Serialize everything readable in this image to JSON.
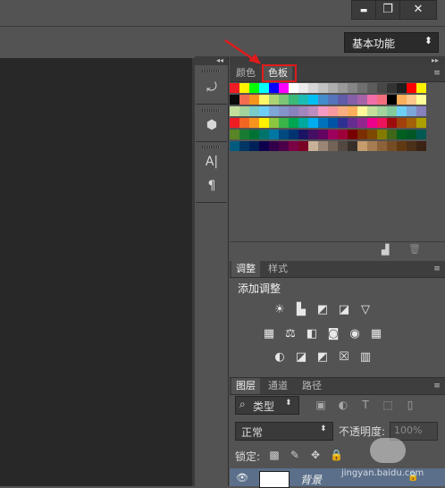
{
  "window": {
    "minimize_icon": "minimize-icon",
    "restore_icon": "restore-icon",
    "close_icon": "close-icon",
    "minimize_glyph": "▬",
    "restore_glyph": "❐",
    "close_glyph": "✕"
  },
  "options_bar": {
    "workspace_label": "基本功能",
    "workspace_arrow": "⬍"
  },
  "tool_dock": {
    "collapse": "◂◂",
    "buttons": [
      {
        "icon": "history-icon",
        "glyph": "⤾"
      },
      {
        "icon": "cube-icon",
        "glyph": "⬢"
      },
      {
        "icon": "character-icon",
        "glyph": "A|"
      },
      {
        "icon": "paragraph-icon",
        "glyph": "¶"
      }
    ]
  },
  "color_panel": {
    "tabs": [
      "颜色",
      "色板"
    ],
    "active_tab": "色板",
    "expand": "▸▸",
    "menu": "≡",
    "swatch_rows": [
      [
        "#ed1c24",
        "#fff200",
        "#00ff00",
        "#00ffff",
        "#0000ff",
        "#ff00ff",
        "#ffffff",
        "#ebebeb",
        "#d6d6d6",
        "#c2c2c2",
        "#adadad",
        "#999999",
        "#858585",
        "#707070",
        "#5c5c5c",
        "#474747",
        "#333333",
        "#1f1f1f",
        "#ff0000",
        "#fff200"
      ],
      [
        "#0a0a0a",
        "#f26c4f",
        "#f7941d",
        "#fff568",
        "#acd373",
        "#7cc576",
        "#3cb878",
        "#1cbbb4",
        "#00bff3",
        "#448ccb",
        "#5574b9",
        "#605ca8",
        "#8560a8",
        "#a763a8",
        "#f06ea9",
        "#f26d7d",
        "#000000",
        "#fbaf5d",
        "#fdc68a",
        "#ffff99"
      ],
      [
        "#c4df9b",
        "#a3d39c",
        "#7accc8",
        "#6dcff6",
        "#7ea7d8",
        "#8493ca",
        "#8882be",
        "#a187be",
        "#bc8dbf",
        "#f49ac2",
        "#f6989d",
        "#f9ad81",
        "#fbaf5d",
        "#fff79a",
        "#c4df9b",
        "#a3d39c",
        "#82ca9c",
        "#6ecff6",
        "#7da7d9",
        "#8781bd"
      ],
      [
        "#ee1d24",
        "#f26522",
        "#f7941d",
        "#fff200",
        "#8dc63f",
        "#39b54a",
        "#00a651",
        "#00a99d",
        "#00aeef",
        "#0072bc",
        "#0054a6",
        "#2e3192",
        "#662d91",
        "#92278f",
        "#ec008c",
        "#ed145b",
        "#9e0b0f",
        "#a0410d",
        "#a36209",
        "#aba000"
      ],
      [
        "#598527",
        "#197b30",
        "#007236",
        "#00746b",
        "#0076a3",
        "#004a80",
        "#003471",
        "#1b1464",
        "#440e62",
        "#630460",
        "#9e005d",
        "#9e0039",
        "#790000",
        "#7b2e00",
        "#7d4900",
        "#827b00",
        "#406618",
        "#005e20",
        "#005826",
        "#005952"
      ],
      [
        "#005b7f",
        "#003663",
        "#002157",
        "#0d004c",
        "#32004b",
        "#4b0049",
        "#7b0046",
        "#7a0026",
        "#c7b299",
        "#998675",
        "#736357",
        "#534741",
        "#37302a",
        "#c69c6d",
        "#a67c52",
        "#8c6239",
        "#754c24",
        "#603913",
        "#4a3018",
        "#3b2314"
      ]
    ],
    "footer_icons": [
      "new-swatch-icon",
      "trash-icon"
    ],
    "footer_glyphs": [
      "▟",
      "🗑"
    ]
  },
  "adjustments_panel": {
    "tabs": [
      "调整",
      "样式"
    ],
    "active_tab": "调整",
    "heading": "添加调整",
    "menu": "≡",
    "icon_rows": [
      [
        {
          "name": "brightness-icon",
          "glyph": "☀"
        },
        {
          "name": "levels-icon",
          "glyph": "▙"
        },
        {
          "name": "curves-icon",
          "glyph": "◩"
        },
        {
          "name": "exposure-icon",
          "glyph": "◪"
        },
        {
          "name": "vibrance-icon",
          "glyph": "▽"
        }
      ],
      [
        {
          "name": "hue-saturation-icon",
          "glyph": "▦"
        },
        {
          "name": "color-balance-icon",
          "glyph": "⚖"
        },
        {
          "name": "black-white-icon",
          "glyph": "◧"
        },
        {
          "name": "photo-filter-icon",
          "glyph": "◙"
        },
        {
          "name": "channel-mixer-icon",
          "glyph": "◉"
        },
        {
          "name": "color-lookup-icon",
          "glyph": "▦"
        }
      ],
      [
        {
          "name": "invert-icon",
          "glyph": "◐"
        },
        {
          "name": "posterize-icon",
          "glyph": "◪"
        },
        {
          "name": "threshold-icon",
          "glyph": "◩"
        },
        {
          "name": "selective-color-icon",
          "glyph": "☒"
        },
        {
          "name": "gradient-map-icon",
          "glyph": "▥"
        }
      ]
    ]
  },
  "layers_panel": {
    "tabs": [
      "图层",
      "通道",
      "路径"
    ],
    "active_tab": "图层",
    "menu": "≡",
    "search_icon": "search-icon",
    "search_glyph": "⌕",
    "filter_kind": "类型",
    "filter_icons": [
      {
        "name": "pixel-filter-icon",
        "glyph": "▣"
      },
      {
        "name": "adjustment-filter-icon",
        "glyph": "◐"
      },
      {
        "name": "type-filter-icon",
        "glyph": "T"
      },
      {
        "name": "shape-filter-icon",
        "glyph": "⬚"
      },
      {
        "name": "smart-object-filter-icon",
        "glyph": "▯"
      }
    ],
    "blend_mode": "正常",
    "opacity_label": "不透明度:",
    "opacity_value": "100%",
    "lock_label": "锁定:",
    "lock_icons": [
      {
        "name": "lock-transparent-icon",
        "glyph": "▩"
      },
      {
        "name": "lock-image-icon",
        "glyph": "✎"
      },
      {
        "name": "lock-position-icon",
        "glyph": "✥"
      },
      {
        "name": "lock-all-icon",
        "glyph": "🔒"
      }
    ],
    "layer": {
      "name": "背景",
      "visibility_glyph": "👁",
      "lock_glyph": "🔒"
    }
  },
  "annotation": {
    "arrow_color": "#e01b1b",
    "highlight_color": "#e01b1b"
  },
  "watermark": "jingyan.baidu.com"
}
